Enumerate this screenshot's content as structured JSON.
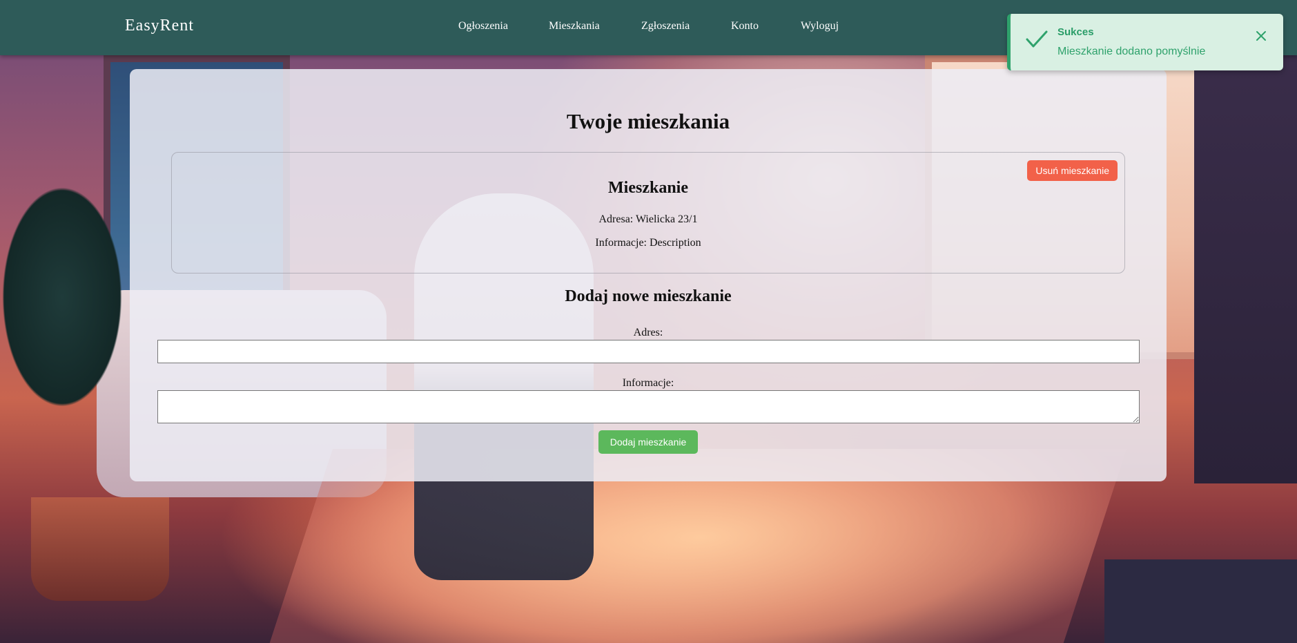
{
  "brand": "EasyRent",
  "nav": {
    "items": [
      {
        "label": "Ogłoszenia"
      },
      {
        "label": "Mieszkania"
      },
      {
        "label": "Zgłoszenia"
      },
      {
        "label": "Konto"
      },
      {
        "label": "Wyloguj"
      }
    ]
  },
  "toast": {
    "title": "Sukces",
    "message": "Mieszkanie dodano pomyślnie",
    "icon": "check-icon",
    "close_icon": "close-icon",
    "accent_color": "#2fa26c"
  },
  "page": {
    "title": "Twoje mieszkania"
  },
  "apartments": [
    {
      "title": "Mieszkanie",
      "address_line": "Adresa: Wielicka 23/1",
      "info_line": "Informacje: Description",
      "delete_label": "Usuń mieszkanie"
    }
  ],
  "form": {
    "title": "Dodaj nowe mieszkanie",
    "address_label": "Adres:",
    "address_value": "",
    "info_label": "Informacje:",
    "info_value": "",
    "submit_label": "Dodaj mieszkanie"
  },
  "colors": {
    "navbar": "#2e5b59",
    "delete_button": "#f26149",
    "add_button": "#5cb85c",
    "toast_bg": "#d9f0e3"
  }
}
